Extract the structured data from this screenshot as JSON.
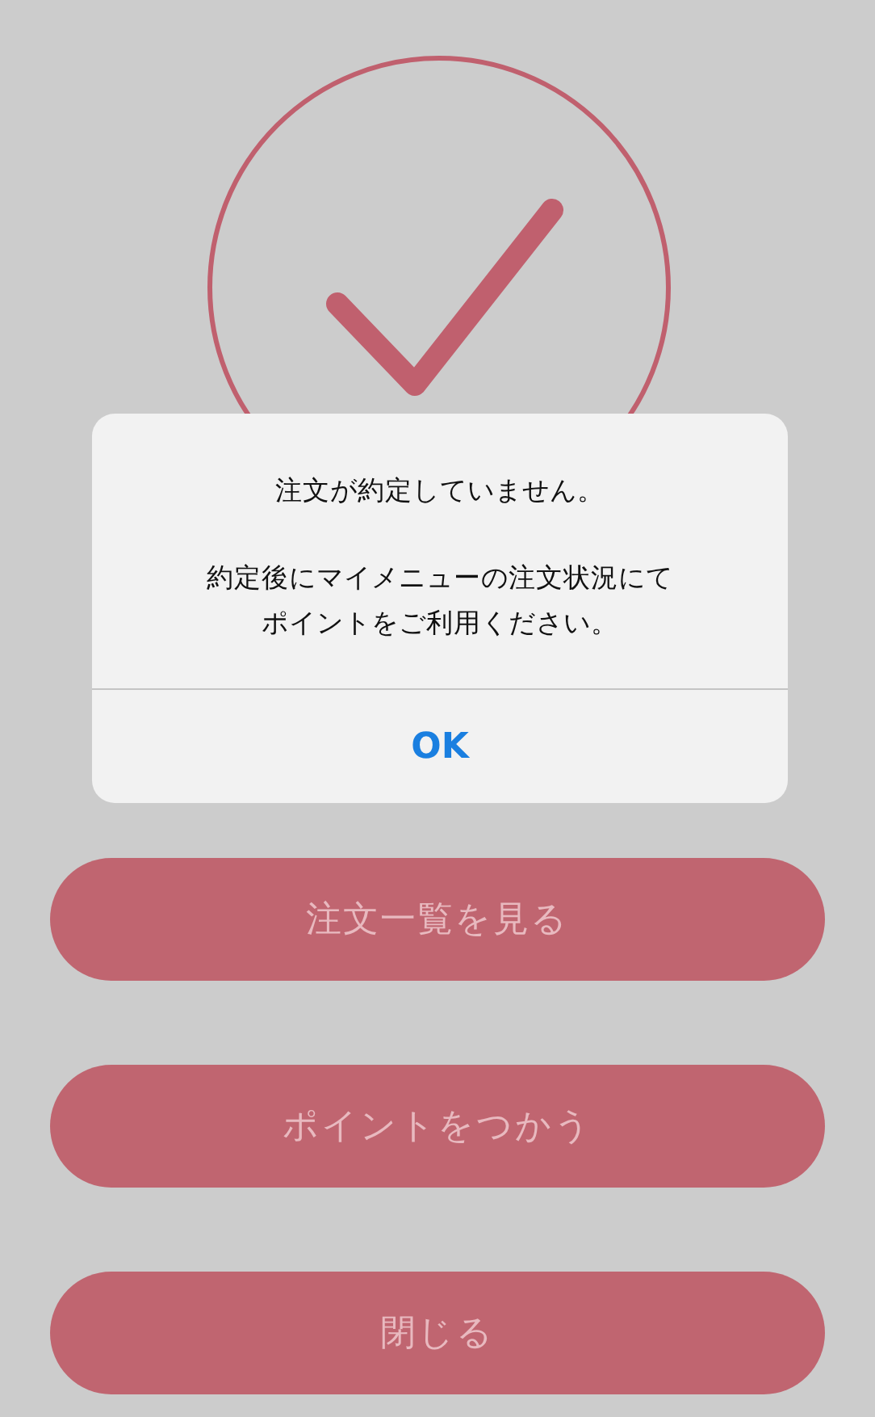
{
  "alert": {
    "title": "注文が約定していません。",
    "message_lines": [
      "約定後にマイメニューの注文状況にて",
      "ポイントをご利用ください。"
    ],
    "button": "OK"
  },
  "buttons": [
    {
      "label": "注文一覧を見る"
    },
    {
      "label": "ポイントをつかう"
    },
    {
      "label": "閉じる"
    }
  ]
}
